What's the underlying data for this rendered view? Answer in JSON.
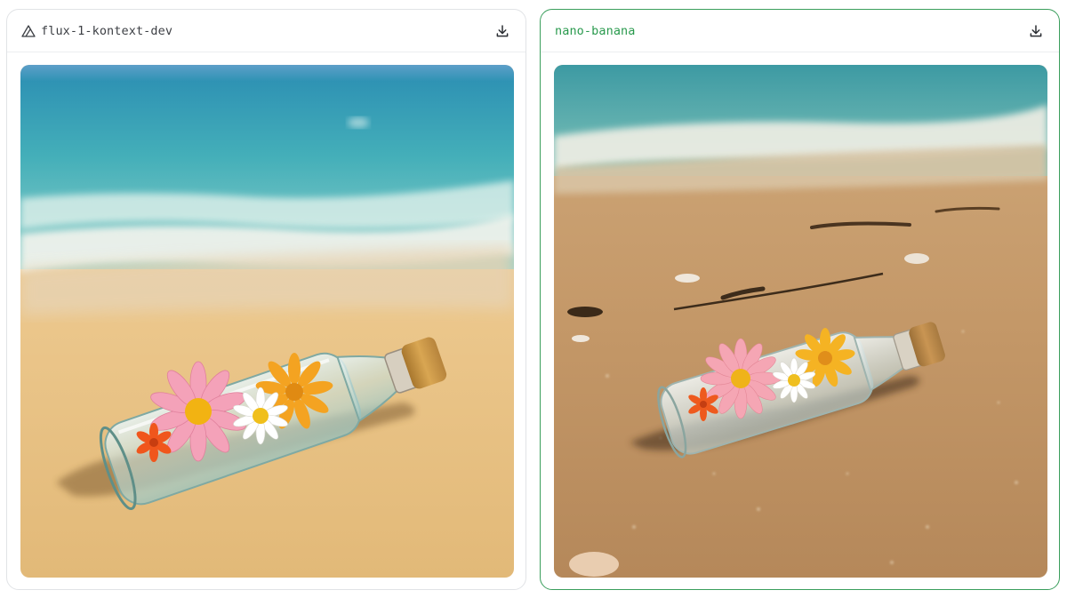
{
  "panels": [
    {
      "model": "flux-1-kontext-dev",
      "icon": "triangle-logo-icon",
      "selected": false
    },
    {
      "model": "nano-banana",
      "icon": "",
      "selected": true
    }
  ],
  "actions": {
    "download_icon": "download-icon"
  },
  "colors": {
    "selected_border": "#3a9e5c",
    "selected_text": "#2a9a4e",
    "card_border": "#e1e3e6"
  }
}
